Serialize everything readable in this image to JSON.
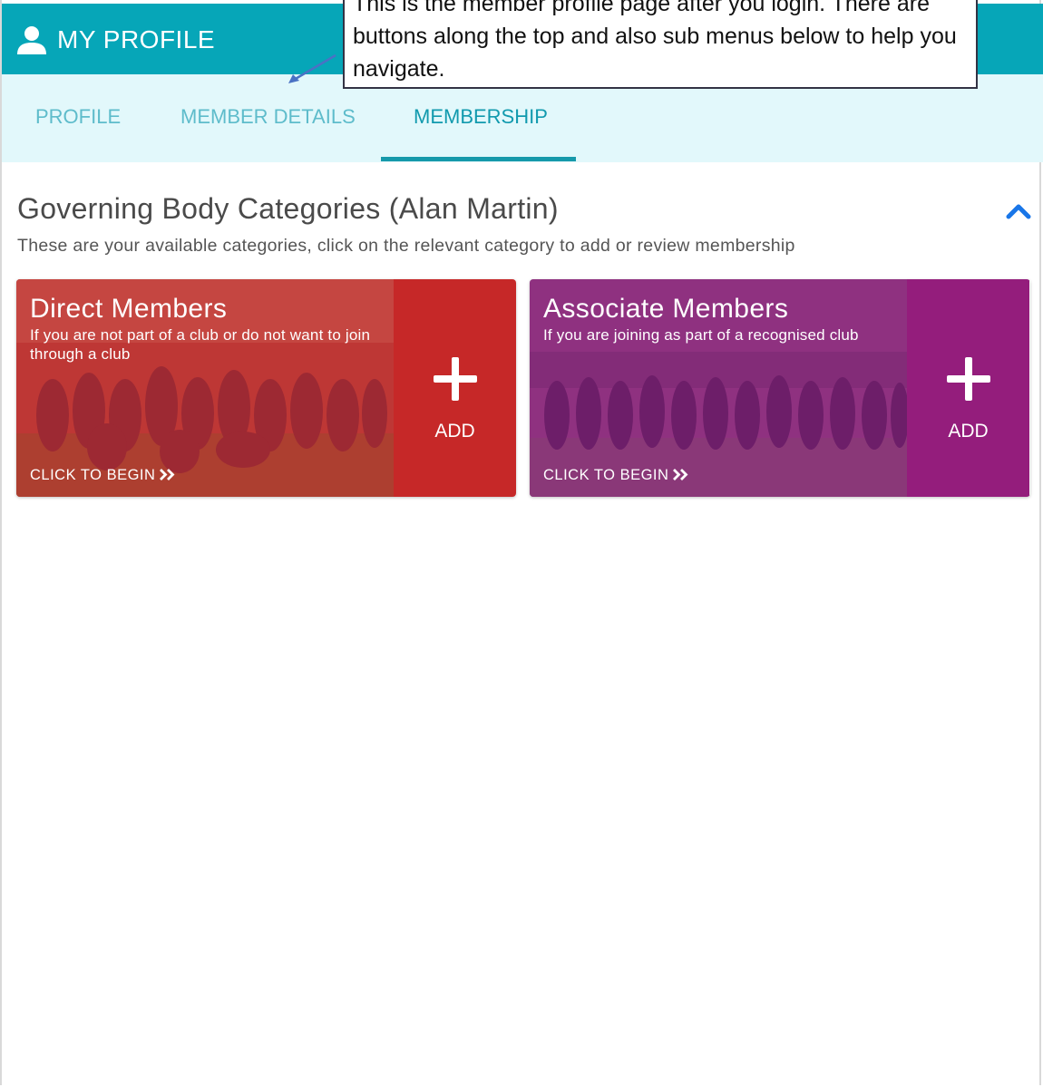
{
  "header": {
    "title": "MY PROFILE",
    "user_icon": "user-icon",
    "color": "#06a6b8"
  },
  "tabs": [
    {
      "label": "PROFILE",
      "active": false
    },
    {
      "label": "MEMBER DETAILS",
      "active": false
    },
    {
      "label": "MEMBERSHIP",
      "active": true
    }
  ],
  "section": {
    "title": "Governing Body Categories (Alan Martin)",
    "description": "These are your available categories, click on the relevant category to add or review membership",
    "collapse_icon": "chevron-up-icon"
  },
  "cards": [
    {
      "title": "Direct Members",
      "subtitle": "If you are not part of a club or do not want to join through a club",
      "cta": "CLICK TO BEGIN",
      "add_label": "ADD",
      "color": "#c62828"
    },
    {
      "title": "Associate Members",
      "subtitle": "If you are joining as part of a recognised club",
      "cta": "CLICK TO BEGIN",
      "add_label": "ADD",
      "color": "#941d7c"
    }
  ],
  "callout": {
    "text": "This is the member profile page after you login. There are buttons along the top and also sub menus below to help you navigate."
  }
}
